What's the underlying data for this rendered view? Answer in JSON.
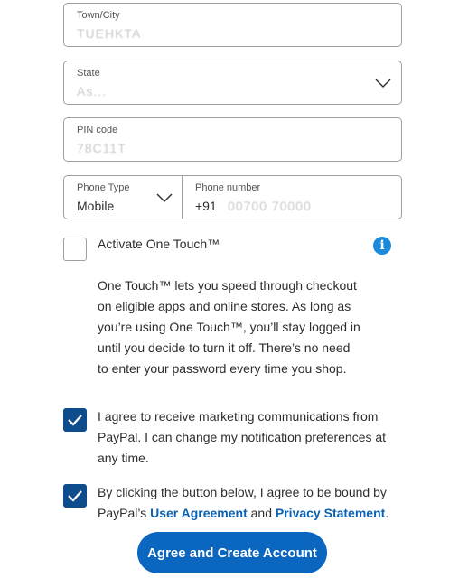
{
  "form": {
    "town": {
      "label": "Town/City",
      "value": "TUEHKTA"
    },
    "state": {
      "label": "State",
      "value": "As..."
    },
    "pin": {
      "label": "PIN code",
      "value": "78C11T"
    },
    "phone_type": {
      "label": "Phone Type",
      "value": "Mobile"
    },
    "phone_number": {
      "label": "Phone number",
      "prefix": "+91",
      "value": "00700 70000"
    }
  },
  "one_touch": {
    "label": "Activate One Touch™",
    "checked": false,
    "description_lines": [
      "One Touch™ lets you speed through checkout",
      "on eligible apps and online stores. As long as",
      "you’re using One Touch™, you’ll stay logged in",
      "until you decide to turn it off. There’s no need",
      "to enter your password every time you shop."
    ]
  },
  "marketing": {
    "checked": true,
    "lines": [
      "I agree to receive marketing communications from",
      "PayPal. I can change my notification preferences at",
      "any time."
    ]
  },
  "terms": {
    "checked": true,
    "line1": "By clicking the button below, I agree to be bound by",
    "line2_prefix": "PayPal’s ",
    "user_agreement": "User Agreement",
    "and": " and ",
    "privacy_statement": "Privacy Statement",
    "suffix": "."
  },
  "submit_label": "Agree and Create Account",
  "colors": {
    "accent": "#0b66c0",
    "checkbox": "#0e4c8c",
    "link": "#0b62b3",
    "info": "#1a8ad9"
  }
}
